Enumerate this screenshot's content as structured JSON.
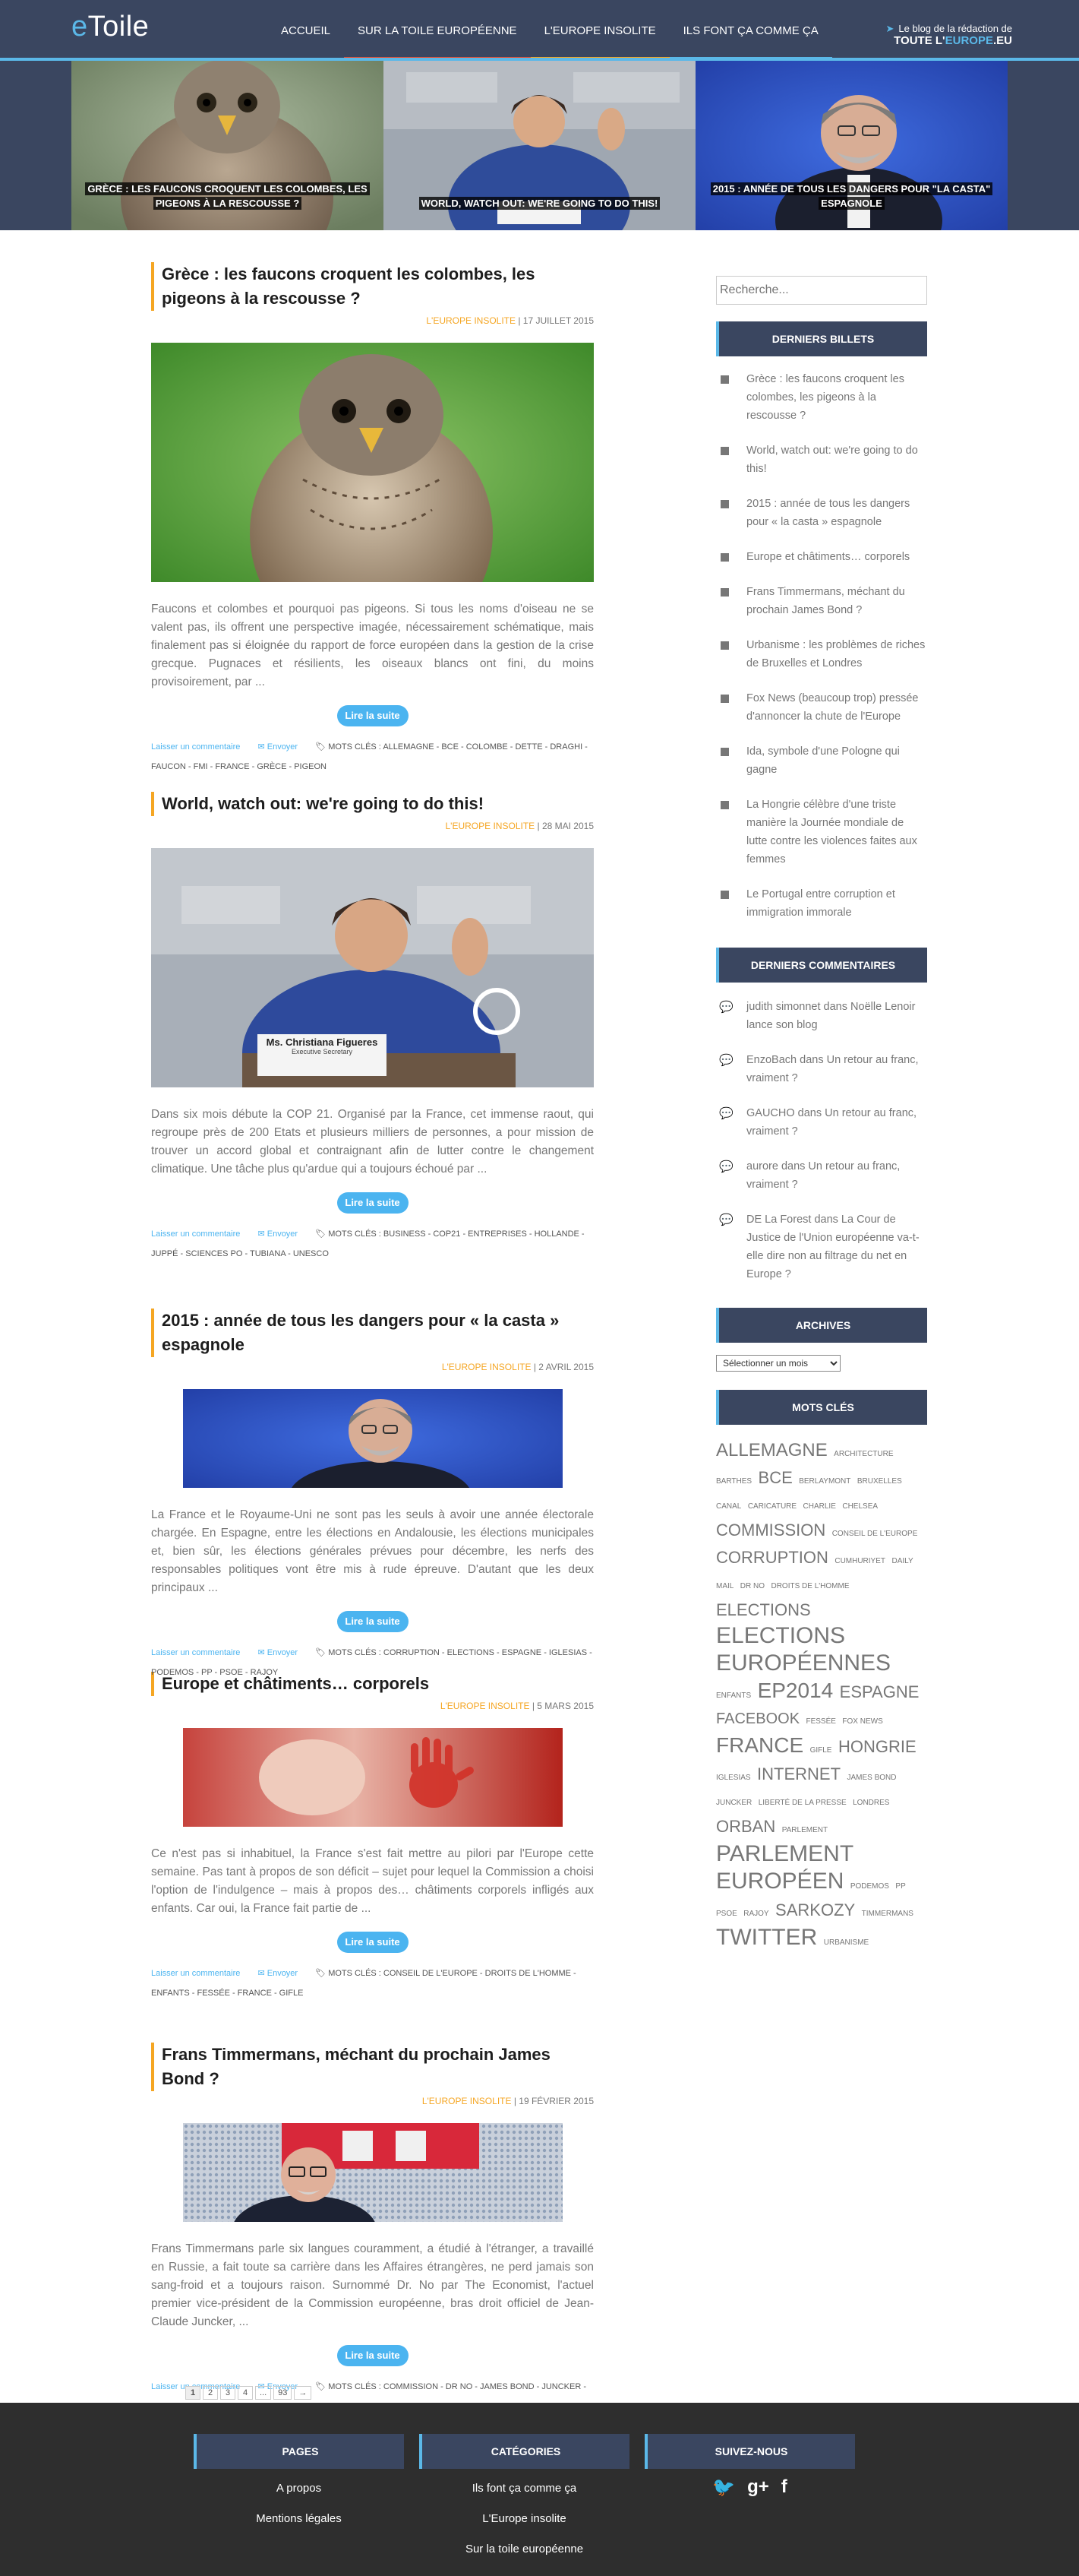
{
  "header": {
    "logo_e": "e",
    "logo_rest": "Toile",
    "nav": [
      {
        "label": "ACCUEIL",
        "color": "#3a4660"
      },
      {
        "label": "SUR LA TOILE EUROPÉENNE",
        "color": "#e64a2e"
      },
      {
        "label": "L'EUROPE INSOLITE",
        "color": "#f5a623"
      },
      {
        "label": "ILS FONT ÇA COMME ÇA",
        "color": "#5bb8e8"
      }
    ],
    "tagline_1": "Le blog de la rédaction de",
    "tagline_2": "TOUTE L'",
    "tagline_3": "EUROPE",
    "tagline_4": ".EU"
  },
  "slider": [
    {
      "caption": "GRÈCE : LES FAUCONS CROQUENT LES COLOMBES, LES PIGEONS À LA RESCOUSSE ?"
    },
    {
      "caption": "WORLD, WATCH OUT: WE'RE GOING TO DO THIS!"
    },
    {
      "caption": "2015 : ANNÉE DE TOUS LES DANGERS POUR \"LA CASTA\" ESPAGNOLE"
    }
  ],
  "posts": [
    {
      "title": "Grèce : les faucons croquent les colombes, les pigeons à la rescousse ?",
      "category": "L'EUROPE INSOLITE",
      "date": "| 17 JUILLET 2015",
      "excerpt": "Faucons et colombes et pourquoi pas pigeons. Si tous les noms d'oiseau ne se valent pas, ils offrent une perspective imagée, nécessairement schématique, mais finalement pas si éloignée du rapport de force européen dans la gestion de la crise grecque. Pugnaces et résilients, les oiseaux blancs ont fini, du moins provisoirement, par ...",
      "tags": "MOTS CLÉS : ALLEMAGNE - BCE - COLOMBE - DETTE - DRAGHI - FAUCON - FMI - FRANCE - GRÈCE - PIGEON"
    },
    {
      "title": "World, watch out: we're going to do this!",
      "category": "L'EUROPE INSOLITE",
      "date": "| 28 MAI 2015",
      "excerpt": "Dans six mois débute la COP 21. Organisé par la France, cet immense raout, qui regroupe près de 200 Etats et plusieurs milliers de personnes, a pour mission de trouver un accord global et contraignant afin de lutter contre le changement climatique. Une tâche plus qu'ardue qui a toujours échoué par ...",
      "tags": "MOTS CLÉS : BUSINESS - COP21 - ENTREPRISES - HOLLANDE - JUPPÉ - SCIENCES PO - TUBIANA - UNESCO",
      "plate_name": "Ms. Christiana Figueres",
      "plate_role": "Executive Secretary"
    },
    {
      "title": "2015 : année de tous les dangers pour « la casta » espagnole",
      "category": "L'EUROPE INSOLITE",
      "date": "| 2 AVRIL 2015",
      "excerpt": "La France et le Royaume-Uni ne sont pas les seuls à avoir une année électorale chargée. En Espagne, entre les élections en Andalousie, les élections municipales et, bien sûr, les élections générales prévues pour décembre, les nerfs des responsables politiques vont être mis à rude épreuve. D'autant que les deux principaux ...",
      "tags": "MOTS CLÉS : CORRUPTION - ELECTIONS - ESPAGNE - IGLESIAS - PODEMOS - PP - PSOE - RAJOY"
    },
    {
      "title": "Europe et châtiments… corporels",
      "category": "L'EUROPE INSOLITE",
      "date": "| 5 MARS 2015",
      "excerpt": "Ce n'est pas si inhabituel, la France s'est fait mettre au pilori par l'Europe cette semaine. Pas tant à propos de son déficit – sujet pour lequel la Commission a choisi l'option de l'indulgence – mais à propos des… châtiments corporels infligés aux enfants. Car oui, la France fait partie de ...",
      "tags": "MOTS CLÉS : CONSEIL DE L'EUROPE - DROITS DE L'HOMME - ENFANTS - FESSÉE - FRANCE - GIFLE"
    },
    {
      "title": "Frans Timmermans, méchant du prochain James Bond ?",
      "category": "L'EUROPE INSOLITE",
      "date": "| 19 FÉVRIER 2015",
      "excerpt": "Frans Timmermans parle six langues couramment, a étudié à l'étranger, a travaillé en Russie, a fait toute sa carrière dans les Affaires étrangères, ne perd jamais son sang-froid et a toujours raison. Surnommé Dr. No par The Economist, l'actuel premier vice-président de la Commission européenne, bras droit officiel de Jean-Claude Juncker, ...",
      "tags": "MOTS CLÉS : COMMISSION - DR NO - JAMES BOND - JUNCKER - TIMMERMANS"
    }
  ],
  "post_ui": {
    "read_more": "Lire la suite",
    "comment": "Laisser un commentaire",
    "send": "Envoyer"
  },
  "pagination": [
    "1",
    "2",
    "3",
    "4",
    "...",
    "93",
    "→"
  ],
  "sidebar": {
    "search_placeholder": "Recherche...",
    "recent_title": "DERNIERS BILLETS",
    "recent": [
      "Grèce : les faucons croquent les colombes, les pigeons à la rescousse ?",
      "World, watch out: we're going to do this!",
      "2015 : année de tous les dangers pour « la casta » espagnole",
      "Europe et châtiments… corporels",
      "Frans Timmermans, méchant du prochain James Bond ?",
      "Urbanisme : les problèmes de riches de Bruxelles et Londres",
      "Fox News (beaucoup trop) pressée d'annoncer la chute de l'Europe",
      "Ida, symbole d'une Pologne qui gagne",
      "La Hongrie célèbre d'une triste manière la Journée mondiale de lutte contre les violences faites aux femmes",
      "Le Portugal entre corruption et immigration immorale"
    ],
    "comments_title": "DERNIERS COMMENTAIRES",
    "comments": [
      "judith simonnet dans Noëlle Lenoir lance son blog",
      "EnzoBach dans Un retour au franc, vraiment ?",
      "GAUCHO dans Un retour au franc, vraiment ?",
      "aurore dans Un retour au franc, vraiment ?",
      "DE La Forest dans La Cour de Justice de l'Union européenne va-t-elle dire non au filtrage du net en Europe ?"
    ],
    "archives_title": "ARCHIVES",
    "archives_select": "Sélectionner un mois",
    "tags_title": "MOTS CLÉS",
    "tags": [
      {
        "t": "ALLEMAGNE",
        "s": 24
      },
      {
        "t": "ARCHITECTURE",
        "s": 10
      },
      {
        "t": "BARTHES",
        "s": 10
      },
      {
        "t": "BCE",
        "s": 22
      },
      {
        "t": "BERLAYMONT",
        "s": 10
      },
      {
        "t": "BRUXELLES",
        "s": 10
      },
      {
        "t": "CANAL",
        "s": 10
      },
      {
        "t": "CARICATURE",
        "s": 10
      },
      {
        "t": "CHARLIE",
        "s": 10
      },
      {
        "t": "CHELSEA",
        "s": 10
      },
      {
        "t": "COMMISSION",
        "s": 22
      },
      {
        "t": "CONSEIL DE L'EUROPE",
        "s": 10
      },
      {
        "t": "CORRUPTION",
        "s": 22
      },
      {
        "t": "CUMHURIYET",
        "s": 10
      },
      {
        "t": "DAILY MAIL",
        "s": 10
      },
      {
        "t": "DR NO",
        "s": 10
      },
      {
        "t": "DROITS DE L'HOMME",
        "s": 10
      },
      {
        "t": "ELECTIONS",
        "s": 22
      },
      {
        "t": "ELECTIONS EUROPÉENNES",
        "s": 30
      },
      {
        "t": "ENFANTS",
        "s": 10
      },
      {
        "t": "EP2014",
        "s": 28
      },
      {
        "t": "ESPAGNE",
        "s": 22
      },
      {
        "t": "FACEBOOK",
        "s": 20
      },
      {
        "t": "FESSÉE",
        "s": 10
      },
      {
        "t": "FOX NEWS",
        "s": 10
      },
      {
        "t": "FRANCE",
        "s": 28
      },
      {
        "t": "GIFLE",
        "s": 10
      },
      {
        "t": "HONGRIE",
        "s": 22
      },
      {
        "t": "IGLESIAS",
        "s": 10
      },
      {
        "t": "INTERNET",
        "s": 22
      },
      {
        "t": "JAMES BOND",
        "s": 10
      },
      {
        "t": "JUNCKER",
        "s": 10
      },
      {
        "t": "LIBERTÉ DE LA PRESSE",
        "s": 10
      },
      {
        "t": "LONDRES",
        "s": 10
      },
      {
        "t": "ORBAN",
        "s": 22
      },
      {
        "t": "PARLEMENT",
        "s": 10
      },
      {
        "t": "PARLEMENT EUROPÉEN",
        "s": 30
      },
      {
        "t": "PODEMOS",
        "s": 10
      },
      {
        "t": "PP",
        "s": 10
      },
      {
        "t": "PSOE",
        "s": 10
      },
      {
        "t": "RAJOY",
        "s": 10
      },
      {
        "t": "SARKOZY",
        "s": 22
      },
      {
        "t": "TIMMERMANS",
        "s": 10
      },
      {
        "t": "TWITTER",
        "s": 30
      },
      {
        "t": "URBANISME",
        "s": 10
      }
    ]
  },
  "footer": {
    "pages_title": "PAGES",
    "pages": [
      "A propos",
      "Mentions légales"
    ],
    "categories_title": "CATÉGORIES",
    "categories": [
      "Ils font ça comme ça",
      "L'Europe insolite",
      "Sur la toile européenne"
    ],
    "follow_title": "SUIVEZ-NOUS",
    "social": [
      {
        "icon": "twitter-icon",
        "glyph": "🐦"
      },
      {
        "icon": "google-plus-icon",
        "glyph": "g+"
      },
      {
        "icon": "facebook-icon",
        "glyph": "f"
      }
    ]
  }
}
